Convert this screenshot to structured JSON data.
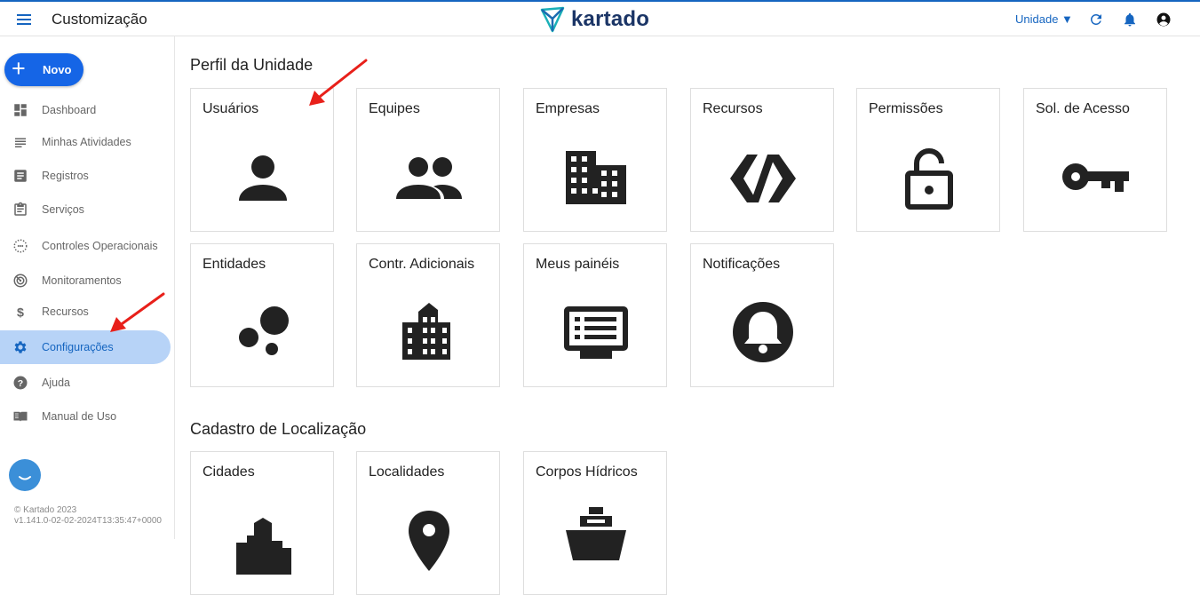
{
  "header": {
    "title": "Customização",
    "logo_text": "kartado",
    "unit_selector": "Unidade ▼",
    "brand_color": "#1565c0"
  },
  "sidebar": {
    "new_button": "Novo",
    "items": [
      {
        "label": "Dashboard",
        "icon": "dashboard-icon"
      },
      {
        "label": "Minhas Atividades",
        "icon": "list-icon"
      },
      {
        "label": "Registros",
        "icon": "document-icon"
      },
      {
        "label": "Serviços",
        "icon": "clipboard-icon"
      },
      {
        "label": "Controles Operacionais",
        "icon": "dotted-circle-icon"
      },
      {
        "label": "Monitoramentos",
        "icon": "radar-icon"
      },
      {
        "label": "Recursos",
        "icon": "dollar-icon"
      },
      {
        "label": "Configurações",
        "icon": "gear-icon",
        "active": true
      },
      {
        "label": "Ajuda",
        "icon": "help-icon"
      },
      {
        "label": "Manual de Uso",
        "icon": "book-icon"
      }
    ],
    "footer_line1": "© Kartado 2023",
    "footer_line2": "v1.141.0-02-02-2024T13:35:47+0000"
  },
  "sections": [
    {
      "title": "Perfil da Unidade",
      "cards": [
        {
          "label": "Usuários",
          "icon": "person-icon"
        },
        {
          "label": "Equipes",
          "icon": "people-icon"
        },
        {
          "label": "Empresas",
          "icon": "building-icon"
        },
        {
          "label": "Recursos",
          "icon": "code-slash-icon"
        },
        {
          "label": "Permissões",
          "icon": "unlocked-padlock-icon"
        },
        {
          "label": "Sol. de Acesso",
          "icon": "key-icon"
        },
        {
          "label": "Entidades",
          "icon": "bubbles-icon"
        },
        {
          "label": "Contr. Adicionais",
          "icon": "city-building-icon"
        },
        {
          "label": "Meus painéis",
          "icon": "monitor-list-icon"
        },
        {
          "label": "Notificações",
          "icon": "bell-circle-icon"
        }
      ]
    },
    {
      "title": "Cadastro de Localização",
      "cards": [
        {
          "label": "Cidades",
          "icon": "city-icon"
        },
        {
          "label": "Localidades",
          "icon": "location-pin-icon"
        },
        {
          "label": "Corpos Hídricos",
          "icon": "ship-icon"
        }
      ]
    }
  ],
  "colors": {
    "annotation_arrow": "#e8201a",
    "active_nav_bg": "#b7d3f7",
    "new_button_bg": "#1565e6"
  }
}
